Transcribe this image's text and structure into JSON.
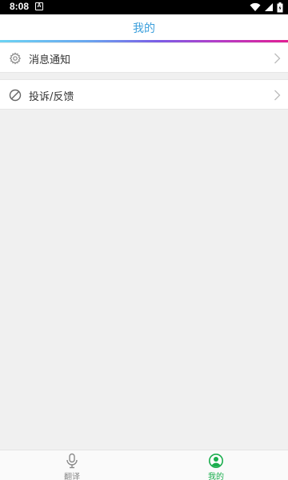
{
  "status_bar": {
    "time": "8:08",
    "notification_badge": "A"
  },
  "header": {
    "title": "我的"
  },
  "menu": {
    "items": [
      {
        "label": "消息通知",
        "icon": "gear-icon"
      },
      {
        "label": "投诉/反馈",
        "icon": "prohibited-icon"
      }
    ]
  },
  "bottom_nav": {
    "items": [
      {
        "label": "翻译",
        "icon": "microphone-icon",
        "active": false
      },
      {
        "label": "我的",
        "icon": "person-circle-icon",
        "active": true
      }
    ]
  },
  "colors": {
    "title": "#3b9fdc",
    "active_tab": "#1aad4d",
    "inactive_tab": "#888888"
  }
}
